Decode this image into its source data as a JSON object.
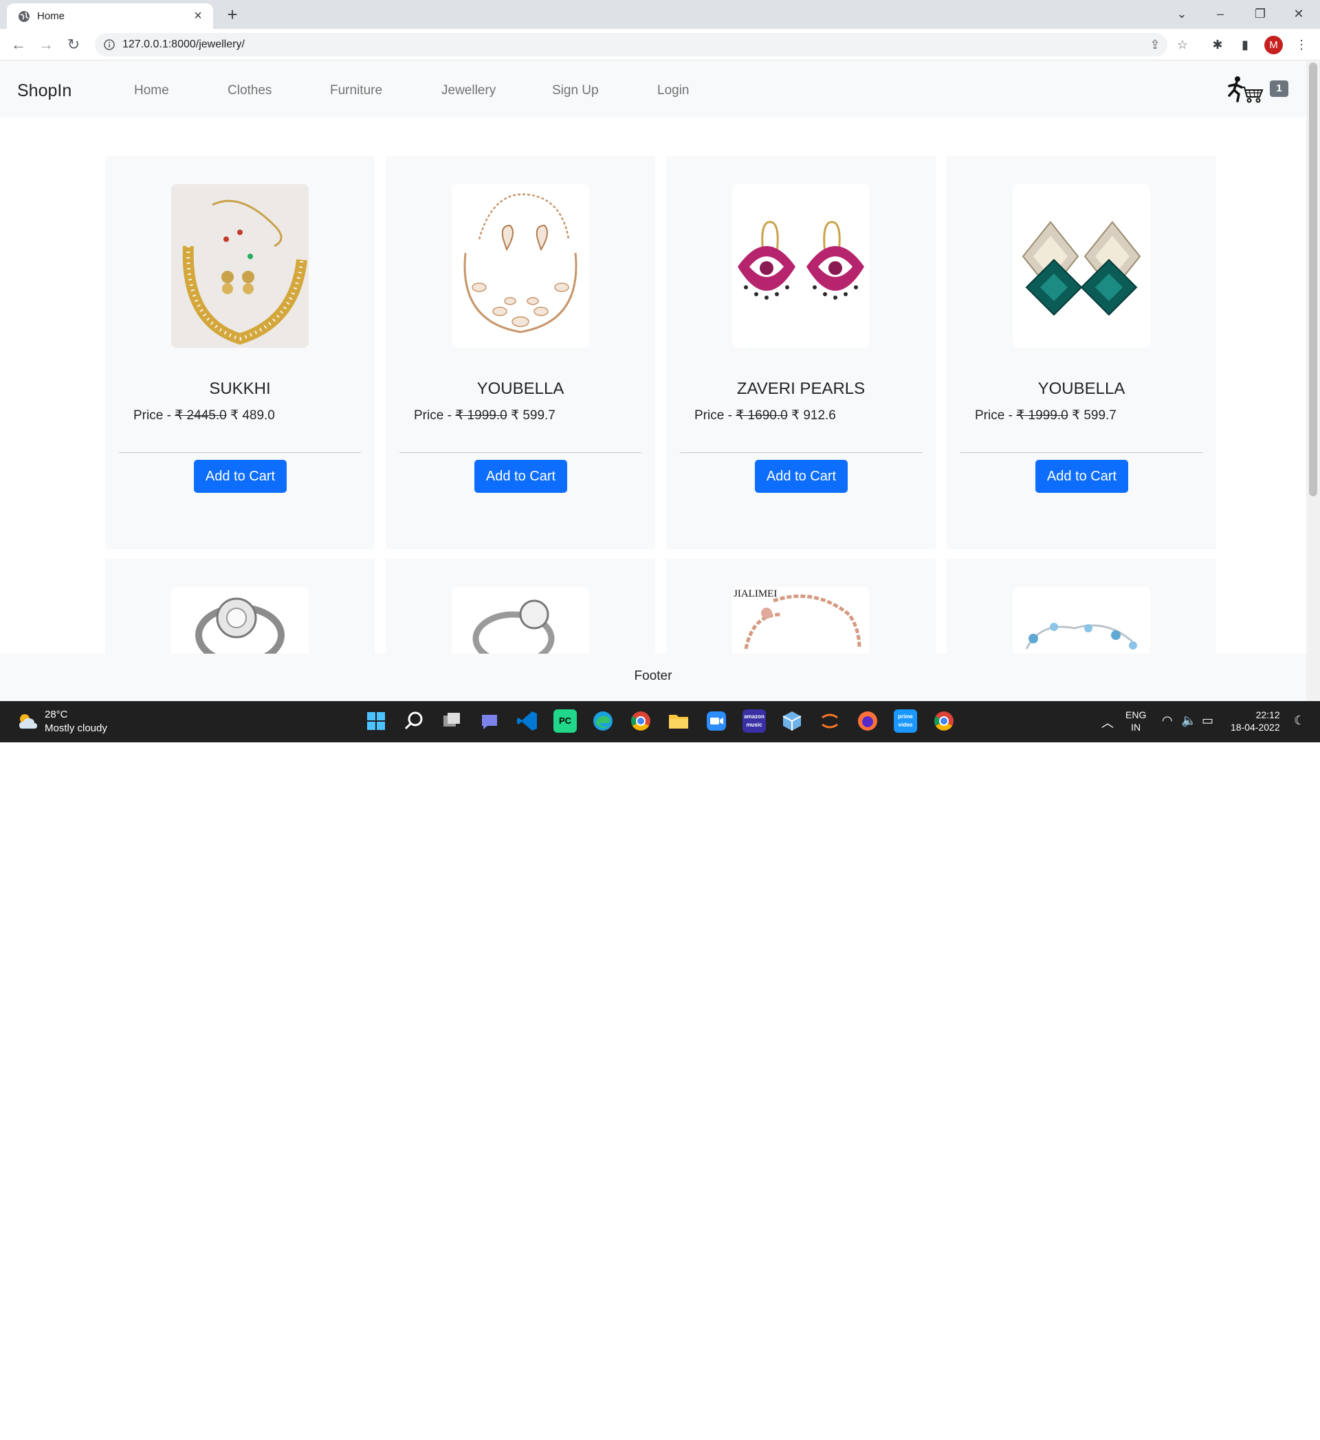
{
  "browser": {
    "tab_title": "Home",
    "url": "127.0.0.1:8000/jewellery/",
    "profile_initial": "M"
  },
  "site": {
    "brand": "ShopIn",
    "nav": [
      "Home",
      "Clothes",
      "Furniture",
      "Jewellery",
      "Sign Up",
      "Login"
    ],
    "cart_count": "1"
  },
  "products": [
    {
      "name": "SUKKHI",
      "price_label": "Price - ",
      "old_price": "₹ 2445.0",
      "new_price": " ₹ 489.0",
      "button": "Add to Cart",
      "image": "gold-pearl-necklace-set"
    },
    {
      "name": "YOUBELLA",
      "price_label": "Price - ",
      "old_price": "₹ 1999.0",
      "new_price": " ₹ 599.7",
      "button": "Add to Cart",
      "image": "rose-gold-crystal-necklace-set"
    },
    {
      "name": "ZAVERI PEARLS",
      "price_label": "Price - ",
      "old_price": "₹ 1690.0",
      "new_price": " ₹ 912.6",
      "button": "Add to Cart",
      "image": "pink-chandbali-earrings"
    },
    {
      "name": "YOUBELLA",
      "price_label": "Price - ",
      "old_price": "₹ 1999.0",
      "new_price": " ₹ 599.7",
      "button": "Add to Cart",
      "image": "green-crystal-drop-earrings"
    }
  ],
  "partial_products": [
    {
      "image": "diamond-ring"
    },
    {
      "image": "solitaire-ring"
    },
    {
      "image": "rose-gold-bracelet",
      "brand_text": "JIALIMEI"
    },
    {
      "image": "blue-crystal-bracelet"
    }
  ],
  "footer": "Footer",
  "taskbar": {
    "weather_temp": "28°C",
    "weather_desc": "Mostly cloudy",
    "lang_top": "ENG",
    "lang_bottom": "IN",
    "time": "22:12",
    "date": "18-04-2022"
  },
  "colors": {
    "primary_button": "#0d6efd",
    "nav_bg": "#f8f9fa",
    "badge": "#6c757d"
  }
}
